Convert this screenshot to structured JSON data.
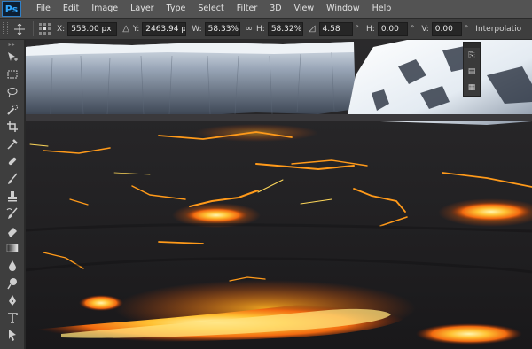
{
  "app": {
    "logo": "Ps"
  },
  "menu": [
    "File",
    "Edit",
    "Image",
    "Layer",
    "Type",
    "Select",
    "Filter",
    "3D",
    "View",
    "Window",
    "Help"
  ],
  "options": {
    "x_label": "X:",
    "x_value": "553.00 px",
    "y_label": "Y:",
    "y_value": "2463.94 p",
    "w_label": "W:",
    "w_value": "58.33%",
    "h_label": "H:",
    "h_value": "58.32%",
    "rot_value": "4.58",
    "rot_unit": "°",
    "hskew_label": "H:",
    "hskew_value": "0.00",
    "hskew_unit": "°",
    "vskew_label": "V:",
    "vskew_value": "0.00",
    "vskew_unit": "°",
    "interp_label": "Interpolatio"
  },
  "tools": [
    "move-tool",
    "marquee-tool",
    "lasso-tool",
    "quick-selection-tool",
    "crop-tool",
    "eyedropper-tool",
    "spot-healing-tool",
    "brush-tool",
    "clone-stamp-tool",
    "history-brush-tool",
    "eraser-tool",
    "gradient-tool",
    "blur-tool",
    "dodge-tool",
    "pen-tool",
    "type-tool",
    "path-selection-tool"
  ],
  "colors": {
    "menubar": "#535353",
    "optionsbar": "#3e3e3e",
    "toolbar": "#3e3e3e",
    "field": "#262626",
    "logo_accent": "#31a8ff"
  }
}
